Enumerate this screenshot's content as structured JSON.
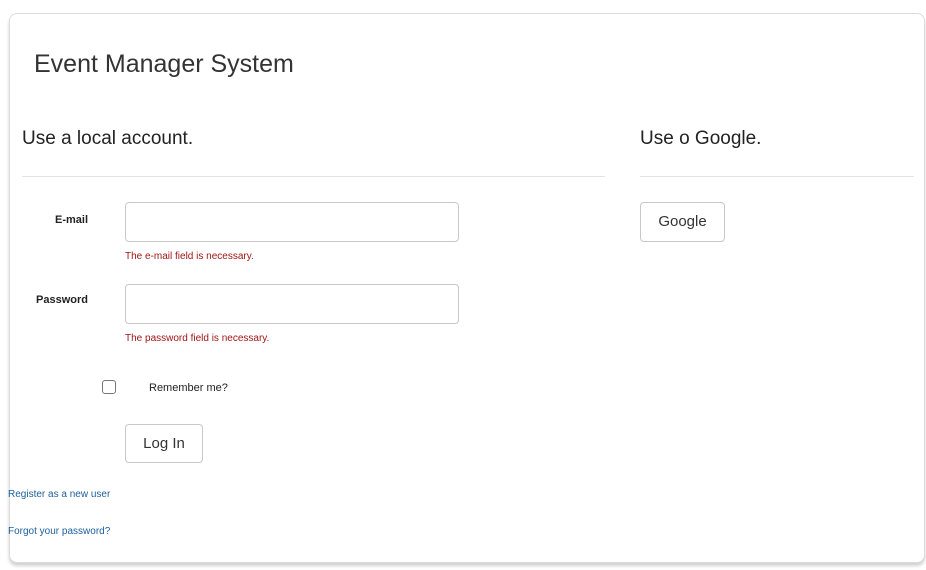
{
  "page": {
    "title": "Event Manager System"
  },
  "local": {
    "heading": "Use a local account.",
    "email_label": "E-mail",
    "email_value": "",
    "email_error": "The e-mail field is necessary.",
    "password_label": "Password",
    "password_value": "",
    "password_error": "The password field is necessary.",
    "remember_label": "Remember me?",
    "remember_checked": false,
    "login_label": "Log In",
    "register_link": "Register as a new user",
    "forgot_link": "Forgot your password?"
  },
  "external": {
    "heading": "Use o Google.",
    "google_button": "Google"
  },
  "colors": {
    "error": "#a01515",
    "link": "#1b5f9a",
    "border": "#c8c8c8"
  }
}
